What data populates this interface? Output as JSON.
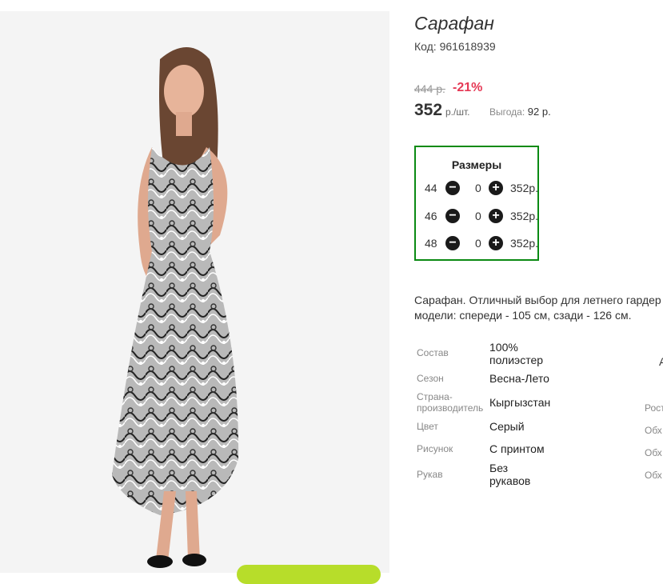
{
  "product": {
    "title": "Сарафан",
    "code": "Код: 961618939",
    "old_price": "444 р.",
    "discount": "-21%",
    "price": "352",
    "price_unit": "р./шт.",
    "savings_label": "Выгода:",
    "savings_value": "92 р."
  },
  "sizes": {
    "title": "Размеры",
    "rows": [
      {
        "size": "44",
        "qty": "0",
        "price": "352р."
      },
      {
        "size": "46",
        "qty": "0",
        "price": "352р."
      },
      {
        "size": "48",
        "qty": "0",
        "price": "352р."
      }
    ],
    "minus_glyph": "−",
    "plus_glyph": "+"
  },
  "description": {
    "line1": "Сарафан. Отличный выбор для летнего гардер",
    "line2": "модели: спереди - 105 см, сзади - 126 см."
  },
  "attributes": [
    {
      "label": "Состав",
      "value_line1": "100%",
      "value_line2": "полиэстер"
    },
    {
      "label": "Сезон",
      "value_line1": "Весна-Лето",
      "value_line2": ""
    },
    {
      "label_line1": "Страна-",
      "label_line2": "производитель",
      "value_line1": "Кыргызстан",
      "value_line2": ""
    },
    {
      "label": "Цвет",
      "value_line1": "Серый",
      "value_line2": ""
    },
    {
      "label": "Рисунок",
      "value_line1": "С принтом",
      "value_line2": ""
    },
    {
      "label": "Рукав",
      "value_line1": "Без",
      "value_line2": "рукавов"
    }
  ],
  "right_cut": {
    "a": "А",
    "rost": "Рост",
    "obkh1": "Обх",
    "obkh2": "Обх",
    "obkh3": "Обх"
  },
  "icons": {
    "minus": "minus-circle-icon",
    "plus": "plus-circle-icon"
  },
  "colors": {
    "accent_green": "#0a8a13",
    "discount_red": "#e53955",
    "button_green": "#b7dd2a"
  }
}
